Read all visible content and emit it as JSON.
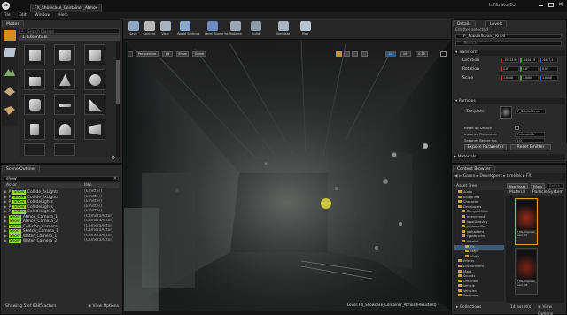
{
  "window": {
    "doc_tab": "FX_Showcase_Container_Atmos",
    "logo": "UE",
    "right_label": "InfiltratorEd"
  },
  "menu": [
    "File",
    "Edit",
    "Window",
    "Help"
  ],
  "modes": {
    "tab": "Modes",
    "search_placeholder": "Search Classes",
    "category": "1. Essentials"
  },
  "toolbar": [
    "Save",
    "Content",
    "View",
    "World Settings",
    "Level Blueprint",
    "Matinee",
    "Build",
    "Simulate",
    "Play"
  ],
  "viewport": {
    "tab": "Viewport 1",
    "buttons": [
      "Perspective",
      "Lit",
      "Show",
      "Game"
    ],
    "level_label": "Level: FX_Showcase_Container_Atmos (Persistent)",
    "snap_values": [
      "10",
      "10°",
      "0.25"
    ]
  },
  "details": {
    "tab": "Details",
    "tab2": "Levels",
    "selected_label": "Emitter selected",
    "name_value": "P_SubtleSteam_Knell",
    "search_placeholder": "Search",
    "transform_header": "Transform",
    "location_label": "Location",
    "location_values": [
      "-15023.9c",
      "-14541.9",
      "-4487.4"
    ],
    "rotation_label": "Rotation",
    "rotation_values": [
      "0.0°",
      "0.0°",
      "0.0°"
    ],
    "scale_label": "Scale",
    "scale_values": [
      "1.0000",
      "1.0000",
      "1.0000"
    ],
    "particles_header": "Particles",
    "template_label": "Template",
    "template_value": "P_SubtleSteam",
    "props": [
      {
        "label": "Reset on Detach",
        "value": ""
      },
      {
        "label": "Instance Parameter",
        "value": "0 elements"
      },
      {
        "label": "Seconds Before Ina",
        "value": "1.0"
      },
      {
        "label": "Custom Time Dilat",
        "value": "1.0"
      }
    ],
    "emitter_actions_header": "Emitter Actions",
    "expose_param": "Expose Parameter",
    "reset_emitter": "Reset Emitter",
    "materials_header": "Materials"
  },
  "outliner": {
    "tab": "Scene Outliner",
    "search_value": "show",
    "col_actor": "Actor",
    "col_info": "Info",
    "rows": [
      {
        "name": "P_Show_Collide_fxLights",
        "type": "(Emitter)"
      },
      {
        "name": "P_Show_Collide_fxLights",
        "type": "(Emitter)"
      },
      {
        "name": "P_Show_CollideLights",
        "type": "(Emitter)"
      },
      {
        "name": "P_Show_CollideLights",
        "type": "(Emitter)"
      },
      {
        "name": "P_Show_CollideLights2",
        "type": "(Emitter)"
      },
      {
        "name": "Show_Atmos_Camera_1",
        "type": "(CameraActor)"
      },
      {
        "name": "Show_Atmos_Camera_2",
        "type": "(CameraActor)"
      },
      {
        "name": "Show_Collision_Camera",
        "type": "(CameraActor)"
      },
      {
        "name": "Show_Sketch_Camera_1",
        "type": "(CameraActor)"
      },
      {
        "name": "Show_Water_Camera_1",
        "type": "(CameraActor)"
      },
      {
        "name": "Show_Water_Camera_2",
        "type": "(CameraActor)"
      }
    ],
    "footer": "Showing 5 of 6385 actors",
    "view_options": "View Options"
  },
  "content_browser": {
    "tab": "Content Browser",
    "path": [
      "Game",
      "Developers",
      "timelek",
      "FX"
    ],
    "asset_tree_label": "Asset Tree",
    "new_asset": "New Asset",
    "filters": "Filters",
    "search": "Search",
    "col_material": "Material",
    "col_particle": "Particle System",
    "folders": [
      "Audio",
      "Blueprints",
      "Character",
      "Developers",
      "DonguaMilkin",
      "interchmcd",
      "jasonbeasley",
      "jordanmiller",
      "joshadams",
      "ryanbrucks",
      "timelek",
      "FX",
      "Maps",
      "Video",
      "Effects",
      "Environment",
      "Maps",
      "Sounds",
      "Unsorted",
      "Vehicle",
      "Vehicles",
      "Weapons"
    ],
    "assets": [
      "P_MeshSplash_Dem_07",
      "P_MeshSplash_Dem_08"
    ],
    "footer_count": "14 asset(s)",
    "view_options": "View Options",
    "collections": "Collections"
  }
}
